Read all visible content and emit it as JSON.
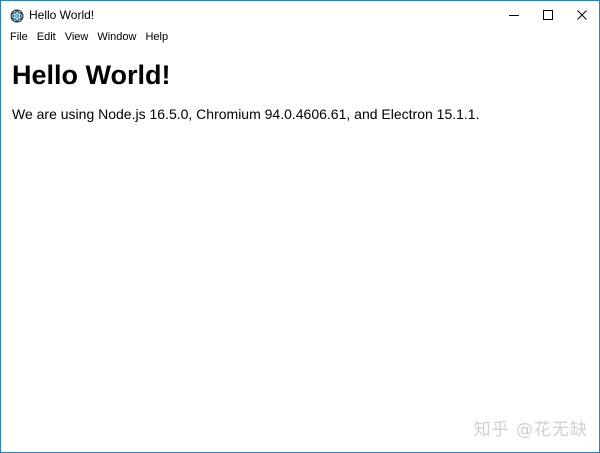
{
  "window": {
    "title": "Hello World!",
    "icon": "electron-logo-icon",
    "controls": [
      "minimize-icon",
      "maximize-icon",
      "close-icon"
    ]
  },
  "menubar": {
    "items": [
      {
        "label": "File"
      },
      {
        "label": "Edit"
      },
      {
        "label": "View"
      },
      {
        "label": "Window"
      },
      {
        "label": "Help"
      }
    ]
  },
  "page": {
    "heading": "Hello World!",
    "text": "We are using Node.js 16.5.0, Chromium 94.0.4606.61, and Electron 15.1.1."
  },
  "watermark": {
    "text": "知乎 @花无缺"
  },
  "colors": {
    "window_border": "#2b7fc9",
    "background": "#ffffff",
    "text": "#000000"
  }
}
